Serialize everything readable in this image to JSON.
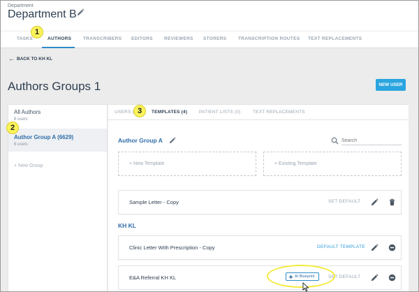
{
  "header": {
    "breadcrumb_label": "Department",
    "title": "Department B",
    "edit_icon": "pencil-icon"
  },
  "tabs": [
    {
      "label": "TASKS",
      "active": false
    },
    {
      "label": "AUTHORS",
      "active": true
    },
    {
      "label": "TRANSCRIBERS",
      "active": false
    },
    {
      "label": "EDITORS",
      "active": false
    },
    {
      "label": "REVIEWERS",
      "active": false
    },
    {
      "label": "STORERS",
      "active": false
    },
    {
      "label": "TRANSCRIPTION ROUTES",
      "active": false
    },
    {
      "label": "TEXT REPLACEMENTS",
      "active": false
    }
  ],
  "back_link": "BACK TO KH KL",
  "page_title": "Authors Groups 1",
  "new_user_button": "NEW USER",
  "groups": [
    {
      "name": "All Authors",
      "count": "8 users",
      "selected": false
    },
    {
      "name": "Author Group A (6629)",
      "count": "8 users",
      "selected": true
    }
  ],
  "new_group": "+ New Group",
  "subtabs": [
    {
      "label": "USERS (8)",
      "active": false
    },
    {
      "label": "TEMPLATES (4)",
      "active": true
    },
    {
      "label": "PATIENT LISTS (0)",
      "active": false
    },
    {
      "label": "TEXT REPLACEMENTS",
      "active": false
    }
  ],
  "group_title": "Author Group A",
  "search": {
    "placeholder": "Search",
    "value": ""
  },
  "new_template": "+ New Template",
  "existing_template": "+ Existing Template",
  "templates": [
    {
      "name": "Sample Letter - Copy",
      "action": "SET DEFAULT",
      "action_color": "#9aa5b1",
      "icons": [
        "pencil-icon",
        "trash-icon"
      ]
    }
  ],
  "section_label": "KH KL",
  "section_templates": [
    {
      "name": "Clinic Letter With Prescription - Copy",
      "action": "DEFAULT TEMPLATE",
      "action_color": "#2e9ad6",
      "icons": [
        "pencil-icon",
        "remove-circle-icon"
      ]
    },
    {
      "name": "E&A Referral KH KL",
      "action": "SET DEFAULT",
      "action_color": "#9aa5b1",
      "icons": [
        "pencil-icon",
        "remove-circle-icon"
      ]
    }
  ],
  "ai_chip": "AI Blueprint",
  "markers": [
    "1",
    "2",
    "3"
  ],
  "colors": {
    "accent": "#2aa5e0",
    "link_blue": "#2f6da8",
    "marker_yellow": "#fbf35a"
  }
}
